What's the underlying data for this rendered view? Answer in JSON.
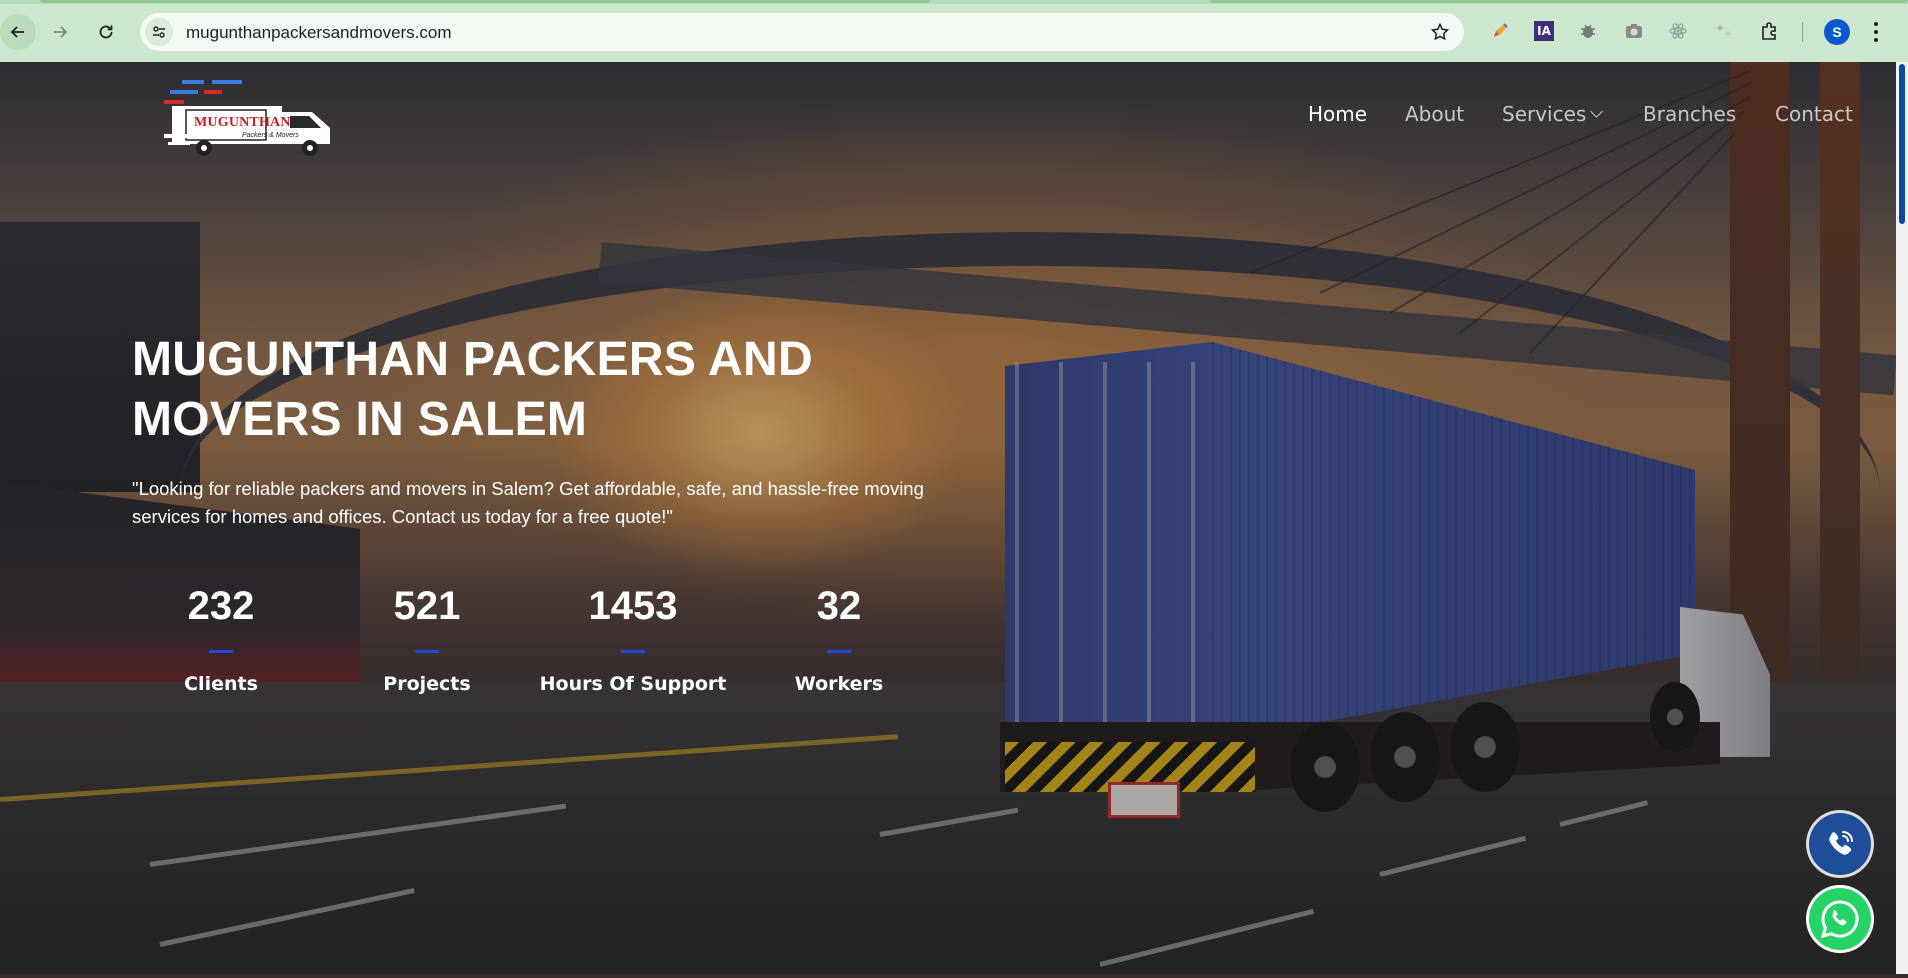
{
  "browser": {
    "url": "mugunthanpackersandmovers.com",
    "profile_initial": "S",
    "icons": [
      "back-arrow-icon",
      "forward-arrow-icon",
      "reload-icon",
      "site-info-icon",
      "bookmark-star-icon",
      "pencil-extension-icon",
      "ia-extension-icon",
      "bug-extension-icon",
      "camera-extension-icon",
      "react-extension-icon",
      "stars-extension-icon",
      "puzzle-extensions-icon",
      "kebab-menu-icon"
    ],
    "ext_ia_label": "IA"
  },
  "site": {
    "logo_text": "MUGUNTHAN",
    "logo_subtext": "Packers & Movers",
    "nav": [
      {
        "label": "Home"
      },
      {
        "label": "About"
      },
      {
        "label": "Services"
      },
      {
        "label": "Branches"
      },
      {
        "label": "Contact"
      }
    ]
  },
  "hero": {
    "title_line1": "MUGUNTHAN PACKERS AND",
    "title_line2": "MOVERS IN SALEM",
    "description": "\"Looking for reliable packers and movers in Salem? Get affordable, safe, and hassle-free moving services for homes and offices. Contact us today for a free quote!\"",
    "stats": [
      {
        "value": "232",
        "label": "Clients"
      },
      {
        "value": "521",
        "label": "Projects"
      },
      {
        "value": "1453",
        "label": "Hours Of Support"
      },
      {
        "value": "32",
        "label": "Workers"
      }
    ]
  },
  "floating": {
    "call_icon": "phone-call-icon",
    "whatsapp_icon": "whatsapp-icon"
  },
  "colors": {
    "chrome_bg": "#cde7cf",
    "accent_bar": "#1d4ed8",
    "whatsapp": "#25d366",
    "call_button": "#1e4e9a"
  }
}
